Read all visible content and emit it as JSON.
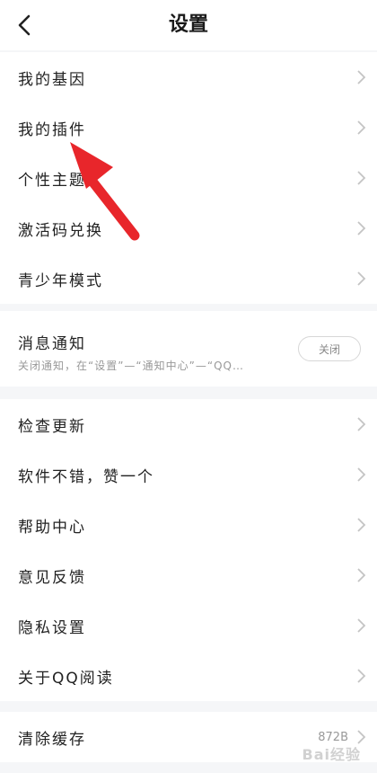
{
  "header": {
    "back_icon": "chevron-left-icon",
    "title": "设置"
  },
  "group1": {
    "items": [
      {
        "label": "我的基因"
      },
      {
        "label": "我的插件"
      },
      {
        "label": "个性主题"
      },
      {
        "label": "激活码兑换"
      },
      {
        "label": "青少年模式"
      }
    ]
  },
  "notify": {
    "title": "消息通知",
    "desc": "关闭通知，在“设置”—“通知中心”—“QQ…",
    "toggle_label": "关闭"
  },
  "group2": {
    "items": [
      {
        "label": "检查更新"
      },
      {
        "label": "软件不错，赞一个"
      },
      {
        "label": "帮助中心"
      },
      {
        "label": "意见反馈"
      },
      {
        "label": "隐私设置"
      },
      {
        "label": "关于QQ阅读"
      }
    ]
  },
  "group3": {
    "items": [
      {
        "label": "清除缓存",
        "value": "872B"
      }
    ]
  },
  "annotation": {
    "arrow_color": "#e8262b"
  },
  "watermark": "Bai经验"
}
